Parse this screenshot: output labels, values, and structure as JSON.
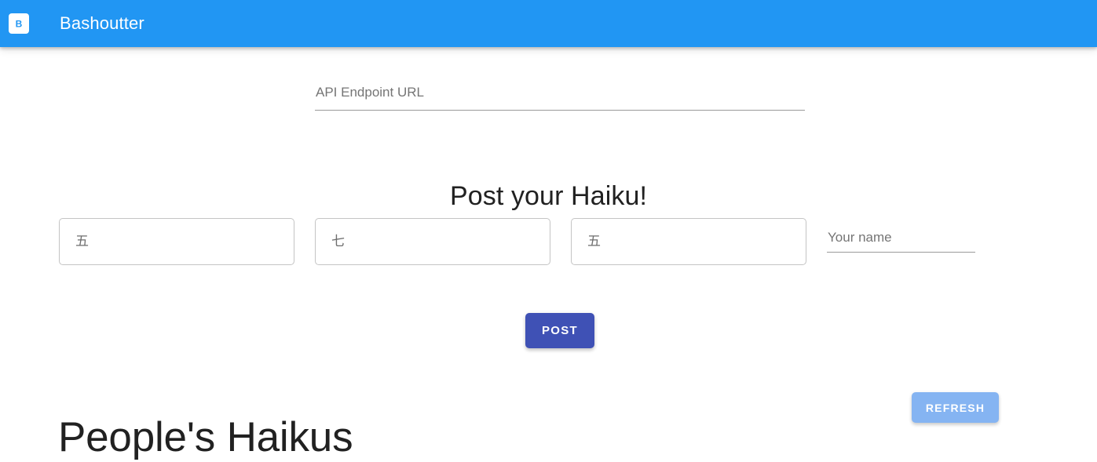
{
  "appbar": {
    "logo_icon": "letter-b-logo-icon",
    "title": "Bashoutter",
    "background_color": "#2196f3"
  },
  "api_field": {
    "placeholder": "API Endpoint URL",
    "value": ""
  },
  "post_section": {
    "heading": "Post your Haiku!",
    "lines": [
      {
        "placeholder": "五",
        "value": ""
      },
      {
        "placeholder": "七",
        "value": ""
      },
      {
        "placeholder": "五",
        "value": ""
      }
    ],
    "name_field": {
      "placeholder": "Your name",
      "value": ""
    },
    "post_button": {
      "label": "POST",
      "color": "#3f51b5"
    }
  },
  "list_section": {
    "heading": "People's Haikus",
    "refresh_button": {
      "label": "REFRESH",
      "color": "#85b4f2"
    }
  }
}
